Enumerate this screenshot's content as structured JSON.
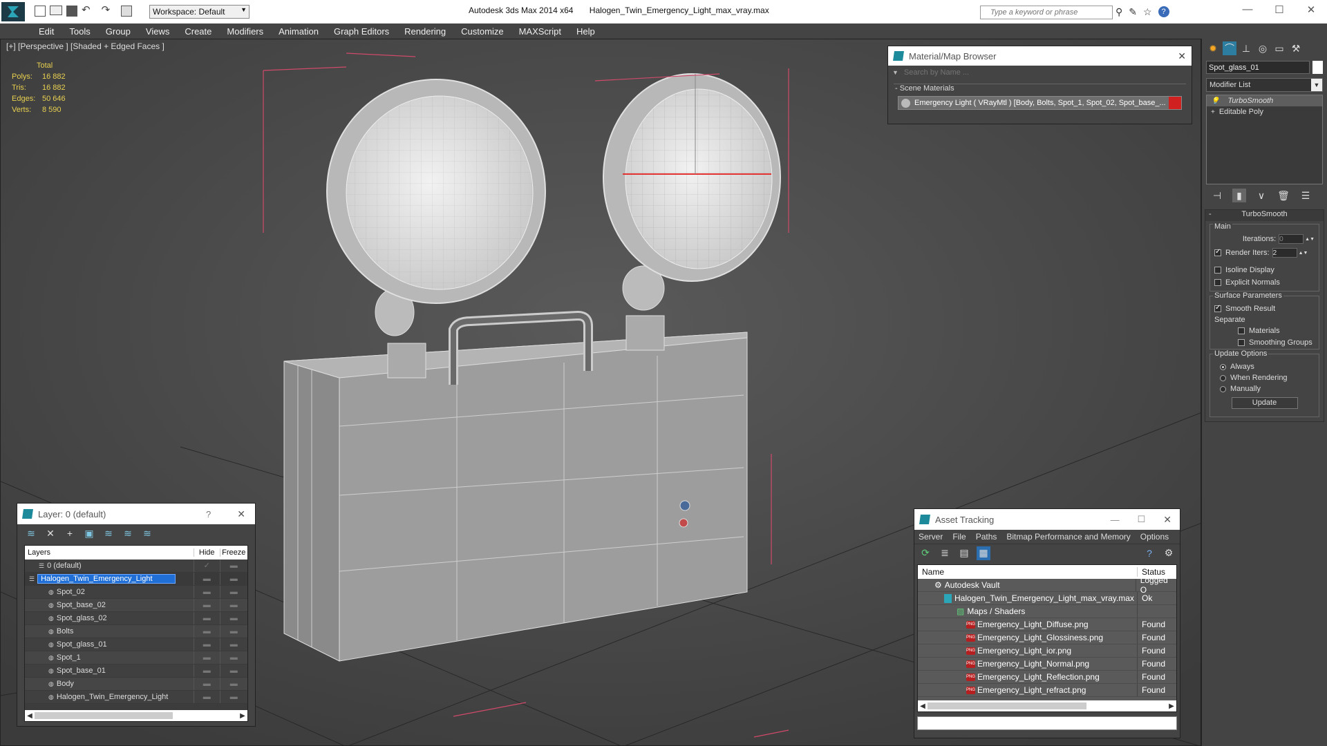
{
  "titlebar": {
    "workspace": "Workspace: Default",
    "app_title": "Autodesk 3ds Max  2014 x64",
    "file_title": "Halogen_Twin_Emergency_Light_max_vray.max",
    "search_placeholder": "Type a keyword or phrase"
  },
  "menu": [
    "Edit",
    "Tools",
    "Group",
    "Views",
    "Create",
    "Modifiers",
    "Animation",
    "Graph Editors",
    "Rendering",
    "Customize",
    "MAXScript",
    "Help"
  ],
  "viewport": {
    "label": "[+] [Perspective ] [Shaded + Edged Faces ]",
    "stats": {
      "header": "Total",
      "rows": [
        {
          "label": "Polys:",
          "value": "16 882"
        },
        {
          "label": "Tris:",
          "value": "16 882"
        },
        {
          "label": "Edges:",
          "value": "50 646"
        },
        {
          "label": "Verts:",
          "value": "8 590"
        }
      ]
    }
  },
  "material_browser": {
    "title": "Material/Map Browser",
    "search_placeholder": "Search by Name ...",
    "section": "- Scene Materials",
    "item": "Emergency Light  ( VRayMtl ) [Body, Bolts, Spot_1, Spot_02, Spot_base_..."
  },
  "command_panel": {
    "object_name": "Spot_glass_01",
    "modifier_list": "Modifier List",
    "stack": [
      "TurboSmooth",
      "Editable Poly"
    ],
    "rollout_title": "TurboSmooth",
    "main_label": "Main",
    "iterations_label": "Iterations:",
    "iterations_value": "0",
    "render_iters_label": "Render Iters:",
    "render_iters_value": "2",
    "isoline": "Isoline Display",
    "explicit_normals": "Explicit Normals",
    "surface_params": "Surface Parameters",
    "smooth_result": "Smooth Result",
    "separate": "Separate",
    "materials": "Materials",
    "smoothing_groups": "Smoothing Groups",
    "update_options": "Update Options",
    "always": "Always",
    "when_rendering": "When Rendering",
    "manually": "Manually",
    "update_button": "Update"
  },
  "layer_panel": {
    "title": "Layer: 0 (default)",
    "help": "?",
    "col_layers": "Layers",
    "col_hide": "Hide",
    "col_freeze": "Freeze",
    "rows": [
      "0 (default)",
      "Halogen_Twin_Emergency_Light",
      "Spot_02",
      "Spot_base_02",
      "Spot_glass_02",
      "Bolts",
      "Spot_glass_01",
      "Spot_1",
      "Spot_base_01",
      "Body",
      "Halogen_Twin_Emergency_Light"
    ]
  },
  "asset_tracking": {
    "title": "Asset Tracking",
    "menu": [
      "Server",
      "File",
      "Paths",
      "Bitmap Performance and Memory",
      "Options"
    ],
    "col_name": "Name",
    "col_status": "Status",
    "rows": [
      {
        "name": "Autodesk Vault",
        "status": "Logged O"
      },
      {
        "name": "Halogen_Twin_Emergency_Light_max_vray.max",
        "status": "Ok"
      },
      {
        "name": "Maps / Shaders",
        "status": ""
      },
      {
        "name": "Emergency_Light_Diffuse.png",
        "status": "Found"
      },
      {
        "name": "Emergency_Light_Glossiness.png",
        "status": "Found"
      },
      {
        "name": "Emergency_Light_ior.png",
        "status": "Found"
      },
      {
        "name": "Emergency_Light_Normal.png",
        "status": "Found"
      },
      {
        "name": "Emergency_Light_Reflection.png",
        "status": "Found"
      },
      {
        "name": "Emergency_Light_refract.png",
        "status": "Found"
      }
    ]
  },
  "colors": {
    "accent": "#1c8a9a",
    "selection": "#1f6fd6",
    "stats": "#e8d050"
  }
}
